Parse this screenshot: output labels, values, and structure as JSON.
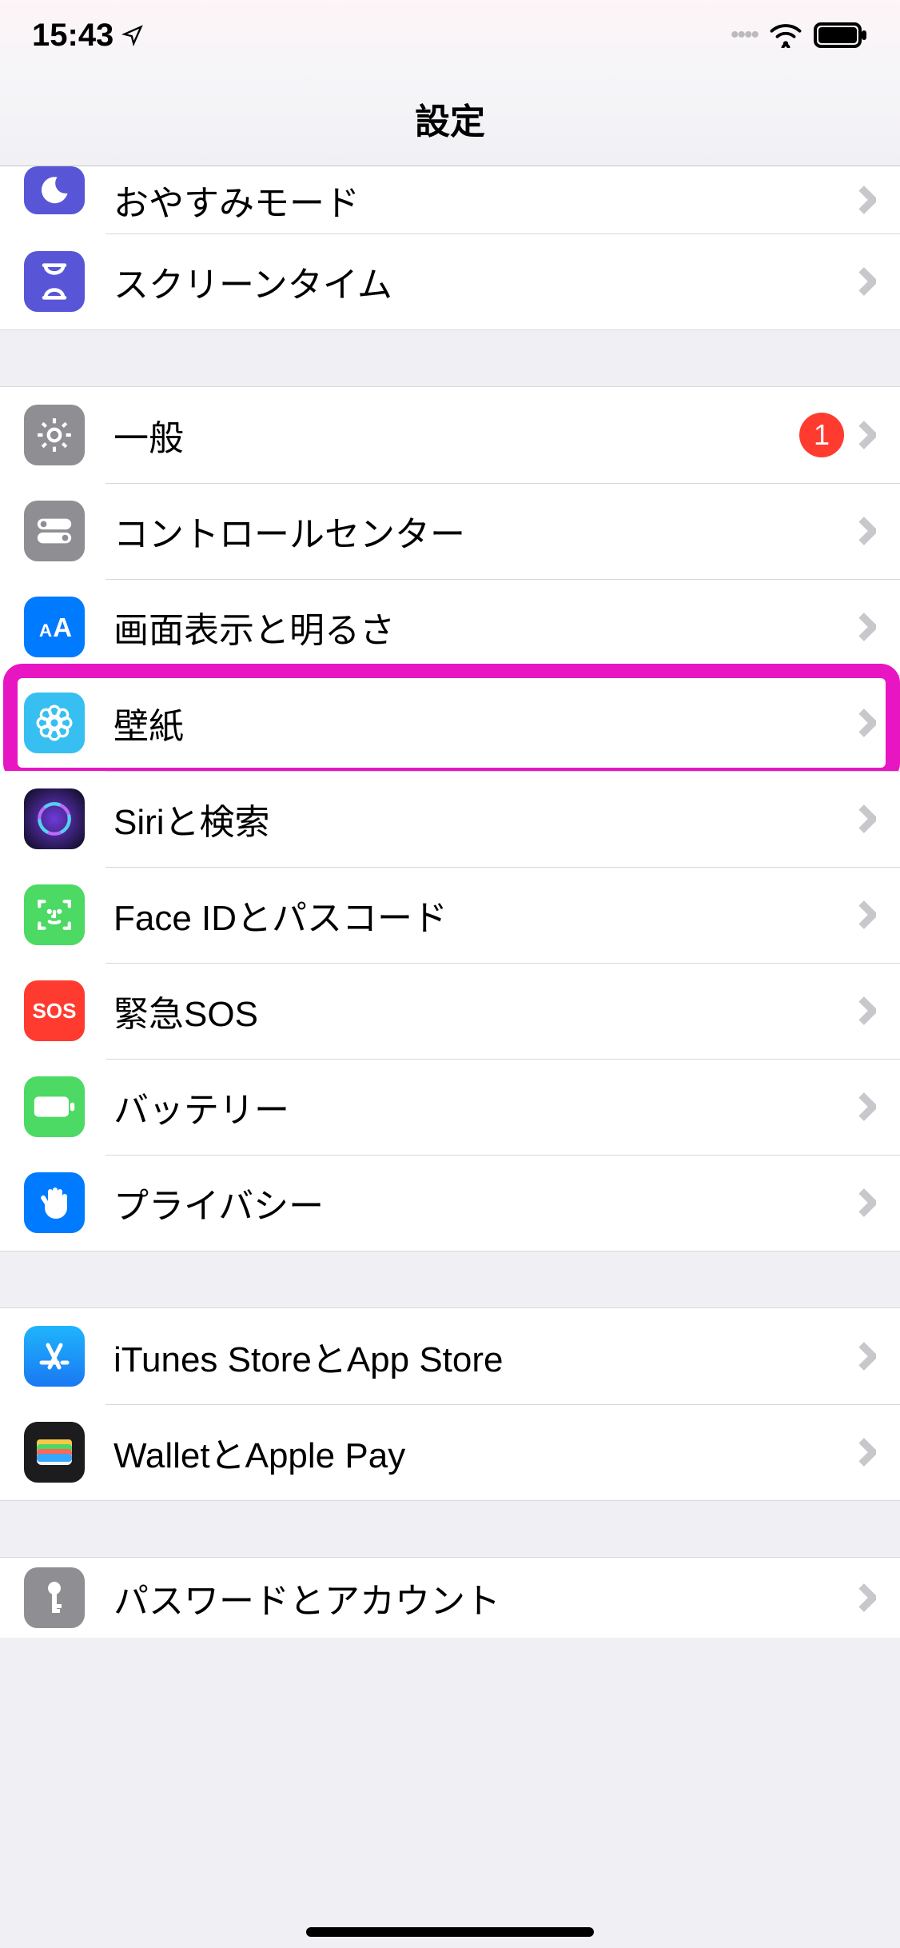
{
  "status": {
    "time": "15:43"
  },
  "nav": {
    "title": "設定"
  },
  "rows": {
    "dnd": {
      "label": "おやすみモード"
    },
    "screentime": {
      "label": "スクリーンタイム"
    },
    "general": {
      "label": "一般",
      "badge": "1"
    },
    "control": {
      "label": "コントロールセンター"
    },
    "display": {
      "label": "画面表示と明るさ"
    },
    "wallpaper": {
      "label": "壁紙"
    },
    "siri": {
      "label": "Siriと検索"
    },
    "faceid": {
      "label": "Face IDとパスコード"
    },
    "sos": {
      "label": "緊急SOS",
      "icon_text": "SOS"
    },
    "battery": {
      "label": "バッテリー"
    },
    "privacy": {
      "label": "プライバシー"
    },
    "itunes": {
      "label": "iTunes StoreとApp Store"
    },
    "wallet": {
      "label": "WalletとApple Pay"
    },
    "passwords": {
      "label": "パスワードとアカウント"
    }
  }
}
